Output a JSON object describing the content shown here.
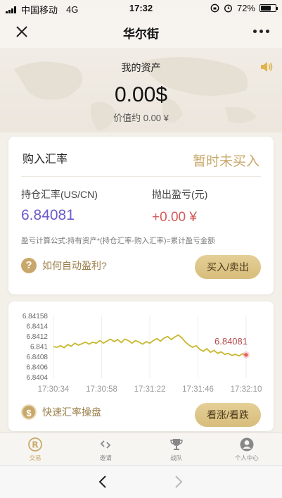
{
  "status_bar": {
    "carrier": "中国移动",
    "network": "4G",
    "time": "17:32",
    "battery": "72%",
    "battery_level": 0.72
  },
  "nav": {
    "title": "华尔街",
    "close_icon": "close-icon",
    "more_icon": "more-dots-icon"
  },
  "hero": {
    "label": "我的资产",
    "amount": "0.00$",
    "sub": "价值约 0.00 ¥"
  },
  "purchase_card": {
    "title": "购入汇率",
    "status": "暂时未买入",
    "holding_rate_label": "持仓汇率(US/CN)",
    "holding_rate_value": "6.84081",
    "pl_label": "抛出盈亏(元)",
    "pl_value": "+0.00 ¥",
    "formula": "盈亏计算公式:持有资产*(持仓汇率-购入汇率)=累计盈亏金额",
    "help_text": "如何自动盈利?",
    "trade_button": "买入/卖出"
  },
  "chart_data": {
    "type": "line",
    "y_ticks": [
      "6.84158",
      "6.8414",
      "6.8412",
      "6.841",
      "6.8408",
      "6.8406",
      "6.8404"
    ],
    "x_ticks": [
      "17:30:34",
      "17:30:58",
      "17:31:22",
      "17:31:46",
      "17:32:10"
    ],
    "ylim": [
      6.84038,
      6.84158
    ],
    "current_label": "6.84081",
    "series": [
      {
        "values": [
          6.84097,
          6.84096,
          6.84099,
          6.84095,
          6.84101,
          6.84098,
          6.84104,
          6.841,
          6.84103,
          6.84106,
          6.84102,
          6.84106,
          6.84104,
          6.84109,
          6.84104,
          6.84108,
          6.84112,
          6.84107,
          6.84111,
          6.84105,
          6.84112,
          6.84109,
          6.84104,
          6.84109,
          6.84106,
          6.84102,
          6.84107,
          6.84104,
          6.84109,
          6.84113,
          6.84108,
          6.84114,
          6.84117,
          6.84111,
          6.84116,
          6.8412,
          6.84114,
          6.84106,
          6.841,
          6.84096,
          6.84099,
          6.84092,
          6.84088,
          6.84093,
          6.84086,
          6.8409,
          6.84084,
          6.84087,
          6.84082,
          6.84084,
          6.8408,
          6.84082,
          6.84079,
          6.84083,
          6.84081
        ]
      }
    ],
    "line_color": "#c9b72e",
    "marker_color": "#e65b5b",
    "label_color": "#b54a4a"
  },
  "quick_card": {
    "text": "快速汇率操盘",
    "button": "看涨/看跌"
  },
  "tabs": [
    {
      "label": "交易",
      "icon": "trade-r-icon",
      "active": true
    },
    {
      "label": "邀请",
      "icon": "invite-link-icon",
      "active": false
    },
    {
      "label": "战队",
      "icon": "trophy-icon",
      "active": false
    },
    {
      "label": "个人中心",
      "icon": "user-profile-icon",
      "active": false
    }
  ],
  "colors": {
    "gold": "#c8a86a",
    "rate_purple": "#6a5bc9",
    "pl_red": "#d35a5a"
  }
}
